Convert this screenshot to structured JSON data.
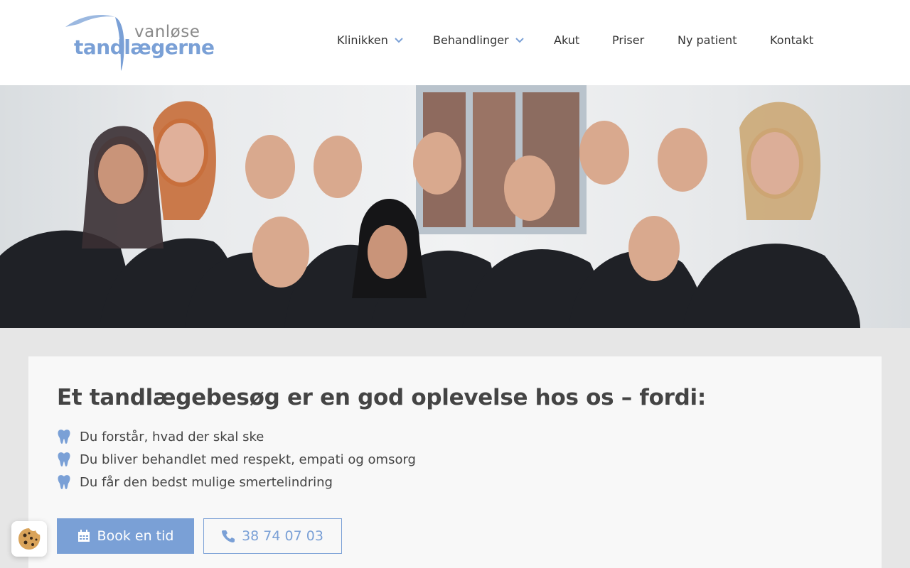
{
  "logo": {
    "top": "vanløse",
    "bottom": "tandlægerne"
  },
  "nav": [
    {
      "label": "Klinikken",
      "has_dropdown": true
    },
    {
      "label": "Behandlinger",
      "has_dropdown": true
    },
    {
      "label": "Akut",
      "has_dropdown": false
    },
    {
      "label": "Priser",
      "has_dropdown": false
    },
    {
      "label": "Ny patient",
      "has_dropdown": false
    },
    {
      "label": "Kontakt",
      "has_dropdown": false
    }
  ],
  "hero": {
    "image": "team-photo-dental-clinic"
  },
  "content": {
    "title": "Et tandlægebesøg er en god oplevelse hos os – fordi:",
    "benefits": [
      "Du forstår, hvad der skal ske",
      "Du bliver behandlet med respekt, empati og omsorg",
      "Du får den bedst mulige smertelindring"
    ],
    "book_label": "Book en tid",
    "phone_label": "38 74 07 03"
  },
  "colors": {
    "accent": "#7aa0d6",
    "text": "#444444",
    "background": "#e6e6e6",
    "card": "#f8f8f8"
  },
  "icons": {
    "benefit": "tooth-icon",
    "book": "calendar-icon",
    "phone": "phone-icon",
    "cookie": "cookie-icon",
    "dropdown": "chevron-down-icon"
  }
}
